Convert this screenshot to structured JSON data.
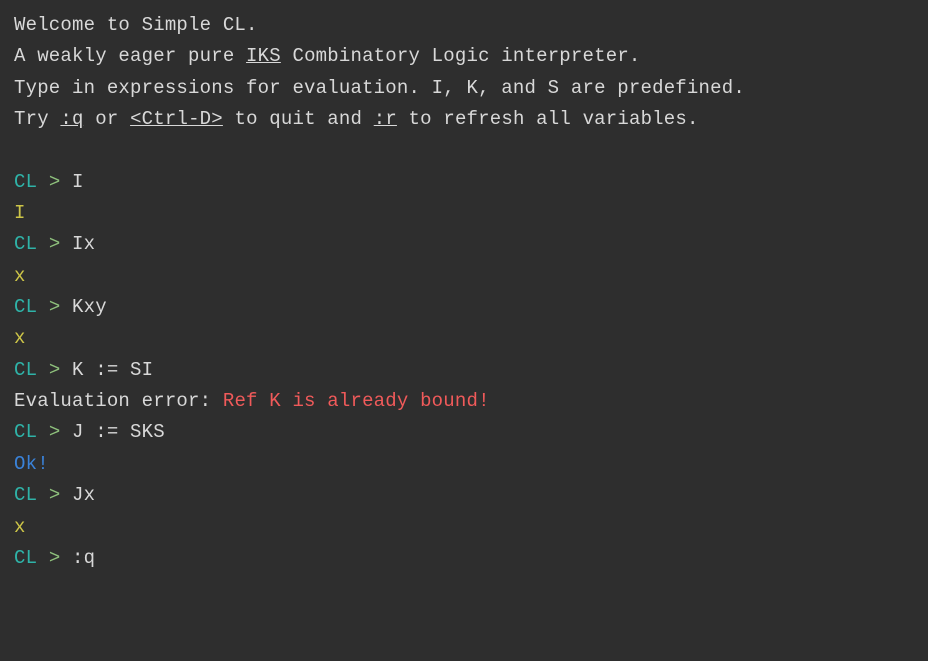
{
  "welcome": {
    "line1": "Welcome to Simple CL.",
    "line2_pre": "A weakly eager pure ",
    "line2_u": "IKS",
    "line2_post": " Combinatory Logic interpreter.",
    "line3": "Type in expressions for evaluation. I, K, and S are predefined.",
    "line4_pre": "Try ",
    "line4_u1": ":q",
    "line4_mid1": " or ",
    "line4_u2": "<Ctrl-D>",
    "line4_mid2": " to quit and ",
    "line4_u3": ":r",
    "line4_post": " to refresh all variables."
  },
  "prompt": {
    "cl": "CL",
    "gt": " > "
  },
  "session": {
    "in1": "I",
    "out1": "I",
    "in2": "Ix",
    "out2": "x",
    "in3": "Kxy",
    "out3": "x",
    "in4": "K := SI",
    "err_label": "Evaluation error: ",
    "err_msg": "Ref K is already bound!",
    "in5": "J := SKS",
    "ok": "Ok!",
    "in6": "Jx",
    "out6": "x",
    "in7": ":q"
  }
}
